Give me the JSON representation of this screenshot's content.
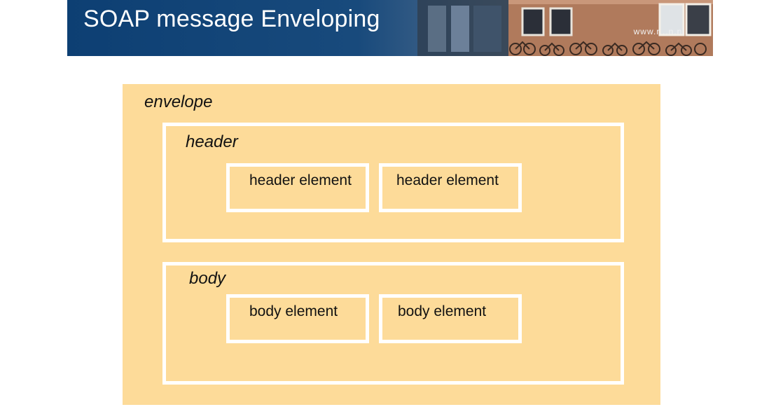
{
  "slide": {
    "title": "SOAP message Enveloping",
    "banner_url": "www.r...n.nl"
  },
  "diagram": {
    "envelope_label": "envelope",
    "header": {
      "label": "header",
      "elements": [
        "header element",
        "header element"
      ]
    },
    "body": {
      "label": "body",
      "elements": [
        "body element",
        "body element"
      ]
    }
  },
  "colors": {
    "banner_blue": "#0d3f73",
    "envelope_fill": "#fddb99",
    "box_border": "#ffffff"
  }
}
